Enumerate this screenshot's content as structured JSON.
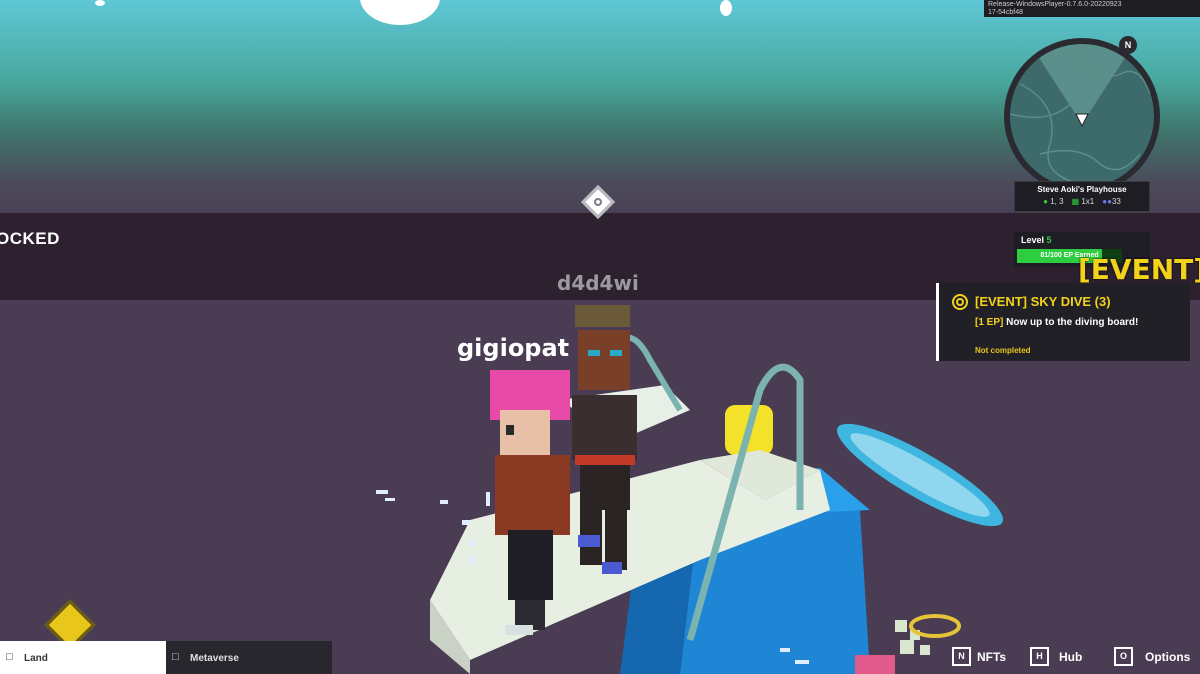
{
  "build": {
    "line1": "Release-WindowsPlayer-0.7.6.0-20220923",
    "line2": "17-54cbf48"
  },
  "world": {
    "banner_text": "OCKED",
    "nametag_remote": "d4d4wi",
    "nametag_local": "gigiopat"
  },
  "minimap": {
    "north": "N"
  },
  "place": {
    "name": "Steve Aoki's Playhouse",
    "coords": "1, 3",
    "size": "1x1",
    "players": "33"
  },
  "level": {
    "label": "Level",
    "value": "5",
    "ep_text": "81/100 EP Earned",
    "progress": 0.81
  },
  "event_big": "[EVENT]",
  "quest": {
    "title": "[EVENT] SKY DIVE (3)",
    "ep": "[1 EP]",
    "description": "Now up to the diving board!",
    "status": "Not completed"
  },
  "bottom": {
    "land_label": "Land",
    "metaverse_label": "Metaverse",
    "nfts_key": "N",
    "nfts_label": "NFTs",
    "hub_key": "H",
    "hub_label": "Hub",
    "options_key": "O",
    "options_label": "Options"
  },
  "colors": {
    "accent_yellow": "#f2d21b",
    "ep_green": "#2ecc40",
    "status_yellow": "#e8c61a"
  }
}
